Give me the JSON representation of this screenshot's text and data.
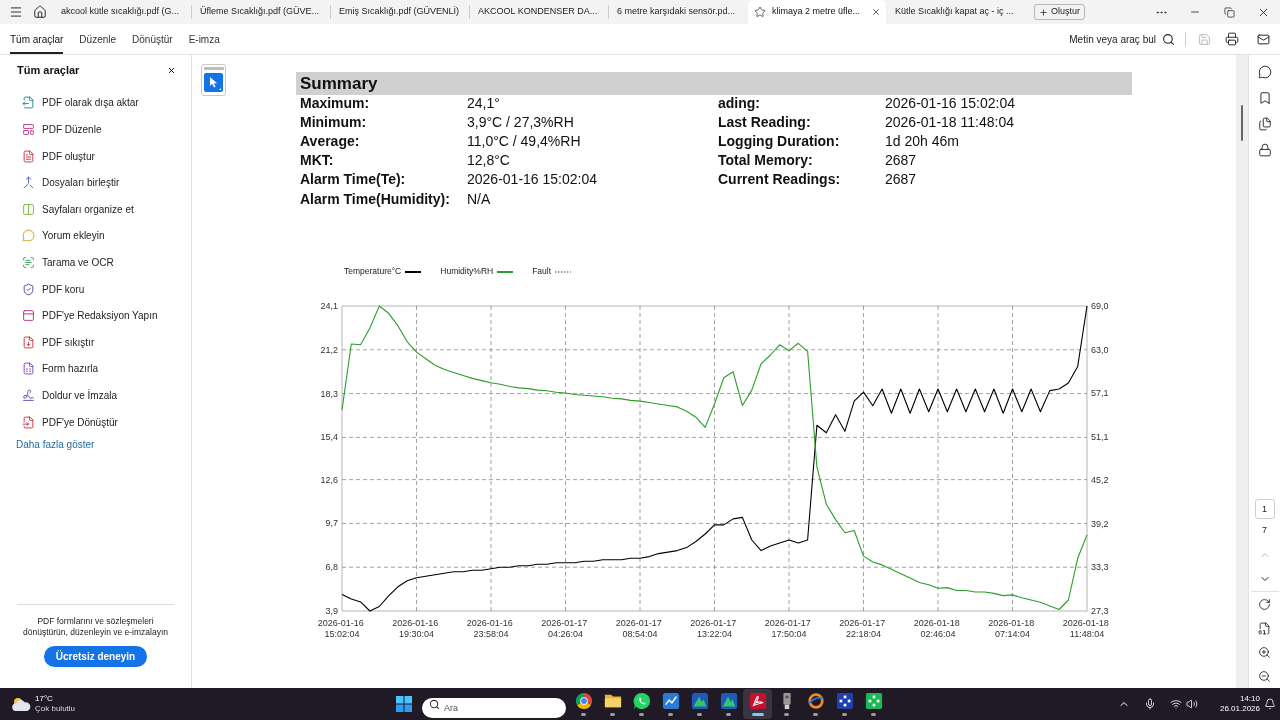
{
  "tab_bar": {
    "tabs": [
      {
        "label": "akcool kütle sıcaklığı.pdf (G...",
        "selected": false
      },
      {
        "label": "Üfleme Sıcaklığı.pdf (GÜVE...",
        "selected": false
      },
      {
        "label": "Emiş Sıcaklığı.pdf (GÜVENLİ)",
        "selected": false
      },
      {
        "label": "AKCOOL KONDENSER DA...",
        "selected": false
      },
      {
        "label": "6 metre karşıdaki sensör.pd...",
        "selected": false
      },
      {
        "label": "klimaya 2 metre üfle...",
        "selected": true
      },
      {
        "label": "Kütle Sıcaklığı kapat aç - iç ...",
        "selected": false
      }
    ],
    "new_button": "Oluştur"
  },
  "toolbar": {
    "tabs": [
      {
        "label": "Tüm araçlar",
        "selected": true
      },
      {
        "label": "Düzenle",
        "selected": false
      },
      {
        "label": "Dönüştür",
        "selected": false
      },
      {
        "label": "E-imza",
        "selected": false
      }
    ],
    "find": "Metin veya araç bul",
    "save_disabled": true
  },
  "sidebar": {
    "title": "Tüm araçlar",
    "items": [
      "PDF olarak dışa aktar",
      "PDF Düzenle",
      "PDF oluştur",
      "Dosyaları birleştir",
      "Sayfaları organize et",
      "Yorum ekleyin",
      "Tarama ve OCR",
      "PDF koru",
      "PDF'ye Redaksiyon Yapın",
      "PDF sıkıştır",
      "Form hazırla",
      "Doldur ve İmzala",
      "PDF'ye Dönüştür"
    ],
    "more_link": "Daha fazla göster",
    "promo_text": "PDF formlarını ve sözleşmeleri dönüştürün, düzenleyin ve e-imzalayın",
    "promo_button": "Ücretsiz deneyin"
  },
  "document": {
    "summary": {
      "title": "Summary",
      "left": [
        {
          "label": "Maximum:",
          "value": "24,1°"
        },
        {
          "label": "Minimum:",
          "value": "3,9°C / 27,3%RH"
        },
        {
          "label": "Average:",
          "value": "11,0°C / 49,4%RH"
        },
        {
          "label": "MKT:",
          "value": "12,8°C"
        },
        {
          "label": "Alarm Time(Te):",
          "value": "2026-01-16 15:02:04"
        },
        {
          "label": "Alarm Time(Humidity):",
          "value": "N/A"
        }
      ],
      "right": [
        {
          "label": "ading:",
          "value": "2026-01-16 15:02:04"
        },
        {
          "label": "Last Reading:",
          "value": "2026-01-18 11:48:04"
        },
        {
          "label": "Logging Duration:",
          "value": "1d 20h 46m"
        },
        {
          "label": "Total Memory:",
          "value": "2687"
        },
        {
          "label": "Current Readings:",
          "value": "2687"
        }
      ]
    },
    "chart": {
      "chart_data": {
        "type": "line",
        "legend": "top-left",
        "grid": true,
        "categories": [
          "2026-01-16 15:02:04",
          null,
          null,
          null,
          null,
          null,
          null,
          null,
          "2026-01-16 19:30:04",
          null,
          null,
          null,
          null,
          null,
          null,
          null,
          "2026-01-16 23:58:04",
          null,
          null,
          null,
          null,
          null,
          null,
          null,
          "2026-01-17 04:26:04",
          null,
          null,
          null,
          null,
          null,
          null,
          null,
          "2026-01-17 08:54:04",
          null,
          null,
          null,
          null,
          null,
          null,
          null,
          "2026-01-17 13:22:04",
          null,
          null,
          null,
          null,
          null,
          null,
          null,
          "2026-01-17 17:50:04",
          null,
          null,
          null,
          null,
          null,
          null,
          null,
          "2026-01-17 22:18:04",
          null,
          null,
          null,
          null,
          null,
          null,
          null,
          "2026-01-18 02:46:04",
          null,
          null,
          null,
          null,
          null,
          null,
          null,
          "2026-01-18 07:14:04",
          null,
          null,
          null,
          null,
          null,
          null,
          null,
          "2026-01-18 11:48:04"
        ],
        "series": [
          {
            "name": "Temperature°C",
            "color": "#000000",
            "values": [
              5.0,
              4.7,
              4.5,
              3.9,
              4.2,
              4.9,
              5.5,
              5.9,
              6.1,
              6.2,
              6.3,
              6.4,
              6.5,
              6.5,
              6.6,
              6.6,
              6.7,
              6.8,
              6.8,
              6.9,
              6.9,
              7.0,
              7.0,
              7.1,
              7.1,
              7.1,
              7.2,
              7.2,
              7.3,
              7.3,
              7.3,
              7.4,
              7.4,
              7.5,
              7.7,
              7.8,
              7.9,
              8.1,
              8.5,
              9.0,
              9.6,
              9.6,
              10.0,
              10.1,
              8.6,
              7.9,
              8.2,
              8.4,
              8.6,
              8.4,
              8.6,
              16.2,
              15.7,
              16.9,
              15.8,
              17.8,
              18.4,
              17.5,
              18.6,
              17.0,
              18.6,
              17.0,
              18.6,
              17.1,
              18.6,
              17.1,
              18.6,
              17.1,
              18.6,
              17.1,
              18.6,
              17.0,
              18.6,
              17.1,
              18.6,
              17.1,
              18.5,
              18.6,
              19.0,
              20.1,
              24.1
            ]
          },
          {
            "name": "Humidity%RH",
            "color": "#2a9d2a",
            "axis": "y2",
            "values": [
              54.8,
              63.8,
              63.7,
              66.0,
              69.0,
              68.0,
              66.3,
              64.1,
              62.7,
              61.8,
              60.9,
              60.3,
              59.9,
              59.5,
              59.1,
              58.8,
              58.5,
              58.3,
              58.0,
              57.8,
              57.7,
              57.5,
              57.4,
              57.2,
              57.1,
              56.9,
              56.8,
              56.7,
              56.6,
              56.4,
              56.3,
              56.1,
              56.0,
              55.8,
              55.6,
              55.4,
              55.2,
              54.6,
              53.8,
              52.4,
              55.6,
              59.2,
              60.0,
              55.4,
              57.5,
              61.1,
              62.3,
              63.7,
              62.9,
              63.9,
              62.8,
              47.0,
              41.9,
              39.8,
              38.0,
              38.3,
              34.8,
              34.0,
              33.6,
              33.0,
              32.4,
              31.8,
              31.2,
              30.9,
              30.4,
              30.5,
              30.1,
              30.1,
              29.9,
              29.9,
              29.7,
              29.4,
              29.5,
              29.1,
              28.8,
              28.5,
              28.0,
              27.5,
              28.8,
              34.5,
              37.7
            ]
          },
          {
            "name": "Fault",
            "color": "#a0a0a0",
            "values": [
              null,
              null,
              null,
              null,
              null,
              null,
              null,
              null,
              null,
              null,
              null,
              null,
              null,
              null,
              null,
              null,
              null,
              null,
              null,
              null,
              null,
              null,
              null,
              null,
              null,
              null,
              null,
              null,
              null,
              null,
              null,
              null,
              null,
              null,
              null,
              null,
              null,
              null,
              null,
              null,
              null,
              null,
              null,
              null,
              null,
              null,
              null,
              null,
              null,
              null,
              null,
              null,
              null,
              null,
              null,
              null,
              null,
              null,
              null,
              null,
              null,
              null,
              null,
              null,
              null,
              null,
              null,
              null,
              null,
              null,
              null,
              null,
              null,
              null,
              null,
              null,
              null,
              null,
              null,
              null,
              null
            ]
          }
        ],
        "ylim": [
          3.9,
          24.1
        ],
        "y2lim": [
          27.3,
          69.0
        ],
        "yticks": [
          {
            "value": 3.9,
            "label": "3,9"
          },
          {
            "value": 6.8,
            "label": "6,8"
          },
          {
            "value": 9.7,
            "label": "9,7"
          },
          {
            "value": 12.6,
            "label": "12,6"
          },
          {
            "value": 15.4,
            "label": "15,4"
          },
          {
            "value": 18.3,
            "label": "18,3"
          },
          {
            "value": 21.2,
            "label": "21,2"
          },
          {
            "value": 24.1,
            "label": "24,1"
          }
        ],
        "y2ticks": [
          {
            "value": 27.3,
            "label": "27,3"
          },
          {
            "value": 33.3,
            "label": "33,3"
          },
          {
            "value": 39.2,
            "label": "39,2"
          },
          {
            "value": 45.2,
            "label": "45,2"
          },
          {
            "value": 51.1,
            "label": "51,1"
          },
          {
            "value": 57.1,
            "label": "57,1"
          },
          {
            "value": 63.0,
            "label": "63,0"
          },
          {
            "value": 69.0,
            "label": "69,0"
          }
        ]
      }
    }
  },
  "page_nav": {
    "current": "1",
    "total": "7",
    "previous_disabled": true
  },
  "taskbar": {
    "weather": {
      "temperature": "17°C",
      "condition": "Çok bulutlu"
    },
    "search_placeholder": "Ara",
    "apps": [
      {
        "selected": false
      },
      {
        "selected": false
      },
      {
        "selected": false
      },
      {
        "selected": false
      },
      {
        "selected": false
      },
      {
        "selected": false
      },
      {
        "selected": true
      },
      {
        "selected": false
      },
      {
        "selected": false
      },
      {
        "selected": false
      },
      {
        "selected": false
      }
    ],
    "clock": {
      "time": "14:10",
      "date": "26.01.2026"
    }
  }
}
